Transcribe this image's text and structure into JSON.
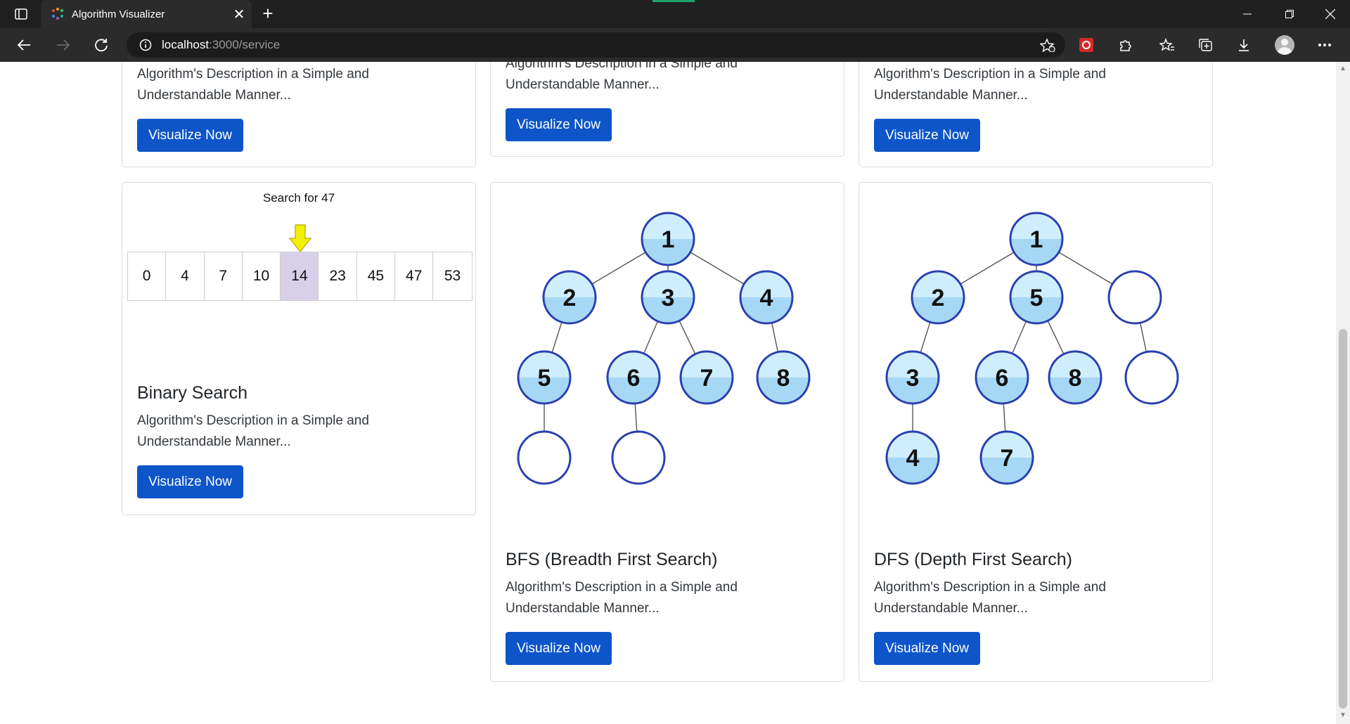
{
  "browser": {
    "tab_title": "Algorithm Visualizer",
    "tab_close": "✕",
    "new_tab": "+",
    "url_host": "localhost",
    "url_path": ":3000/service"
  },
  "cards_top": [
    {
      "description": "Algorithm's Description in a Simple and Understandable Manner...",
      "button": "Visualize Now"
    },
    {
      "description": "Algorithm's Description in a Simple and Understandable Manner...",
      "button": "Visualize Now"
    },
    {
      "description": "Algorithm's Description in a Simple and Understandable Manner...",
      "button": "Visualize Now"
    }
  ],
  "binary_search": {
    "caption": "Search for 47",
    "array": [
      "0",
      "4",
      "7",
      "10",
      "14",
      "23",
      "45",
      "47",
      "53"
    ],
    "highlight_index": 4,
    "title": "Binary Search",
    "description": "Algorithm's Description in a Simple and Understandable Manner...",
    "button": "Visualize Now"
  },
  "bfs": {
    "title": "BFS (Breadth First Search)",
    "description": "Algorithm's Description in a Simple and Understandable Manner...",
    "button": "Visualize Now",
    "nodes": [
      {
        "id": "n1",
        "label": "1",
        "filled": true
      },
      {
        "id": "n2",
        "label": "2",
        "filled": true
      },
      {
        "id": "n3",
        "label": "3",
        "filled": true
      },
      {
        "id": "n4",
        "label": "4",
        "filled": true
      },
      {
        "id": "n5",
        "label": "5",
        "filled": true
      },
      {
        "id": "n6",
        "label": "6",
        "filled": true
      },
      {
        "id": "n7",
        "label": "7",
        "filled": true
      },
      {
        "id": "n8",
        "label": "8",
        "filled": true
      },
      {
        "id": "e1",
        "label": "",
        "filled": false
      },
      {
        "id": "e2",
        "label": "",
        "filled": false
      }
    ]
  },
  "dfs": {
    "title": "DFS (Depth First Search)",
    "description": "Algorithm's Description in a Simple and Understandable Manner...",
    "button": "Visualize Now",
    "nodes": [
      {
        "id": "n1",
        "label": "1",
        "filled": true
      },
      {
        "id": "n2",
        "label": "2",
        "filled": true
      },
      {
        "id": "n5",
        "label": "5",
        "filled": true
      },
      {
        "id": "e1",
        "label": "",
        "filled": false
      },
      {
        "id": "n3",
        "label": "3",
        "filled": true
      },
      {
        "id": "n6",
        "label": "6",
        "filled": true
      },
      {
        "id": "n8",
        "label": "8",
        "filled": true
      },
      {
        "id": "e2",
        "label": "",
        "filled": false
      },
      {
        "id": "n4",
        "label": "4",
        "filled": true
      },
      {
        "id": "n7",
        "label": "7",
        "filled": true
      }
    ]
  },
  "colors": {
    "node_fill_top": "#cfeefd",
    "node_fill_bottom": "#a6d8f6",
    "node_stroke": "#2a3fb0",
    "button": "#0d55c8",
    "highlight_cell": "#d8d0ea",
    "arrow": "#f2f200"
  }
}
